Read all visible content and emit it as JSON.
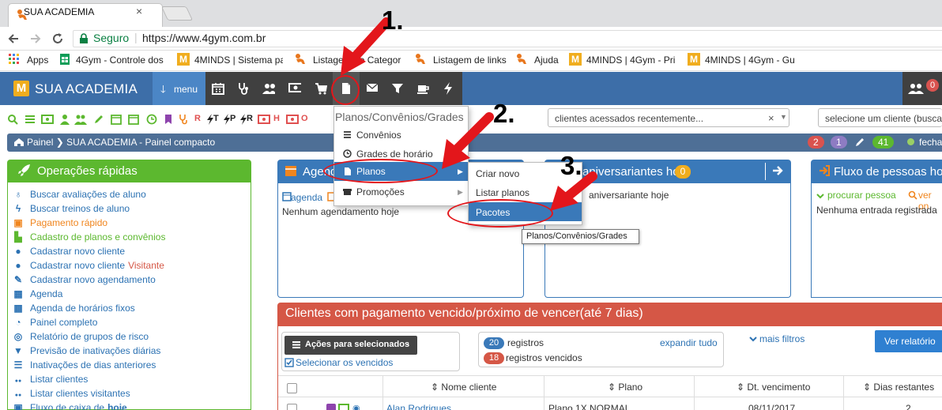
{
  "browser": {
    "tab_title": "SUA ACADEMIA",
    "tab_close": "×",
    "secure_label": "Seguro",
    "url": "https://www.4gym.com.br",
    "bookmarks": [
      {
        "label": "Apps"
      },
      {
        "label": "4Gym - Controle dos"
      },
      {
        "label": "4MINDS | Sistema pa"
      },
      {
        "label": "Listagem de Categor"
      },
      {
        "label": "Listagem de links"
      },
      {
        "label": "Ajuda"
      },
      {
        "label": "4MINDS | 4Gym - Pri"
      },
      {
        "label": "4MINDS | 4Gym - Gu"
      }
    ]
  },
  "nav": {
    "logo_letter": "M",
    "brand": "SUA ACADEMIA",
    "menu_arrow": "🡓",
    "menu_label": "menu",
    "icons": [
      "calendar-icon",
      "stethoscope-icon",
      "users-icon",
      "money-icon",
      "cart-icon",
      "document-icon",
      "envelope-icon",
      "filter-icon",
      "coffee-icon",
      "bolt-icon"
    ],
    "user_badge": "0"
  },
  "quickbar": {
    "letters": [
      "T",
      "P",
      "R",
      "H",
      "O"
    ]
  },
  "selects": {
    "recent_clients": "clientes acessados recentemente...",
    "recent_clear": "×",
    "select_client": "selecione um cliente (busca"
  },
  "breadcrumb": {
    "text": "Painel  ❯  SUA ACADEMIA - Painel compacto",
    "badges": [
      "2",
      "1",
      "41"
    ],
    "close_label": "fecha"
  },
  "quick_ops": {
    "title": "Operações rápidas",
    "items": [
      {
        "label": "Buscar avaliações de aluno",
        "icon": "stethoscope-icon",
        "color": "#2c72b3"
      },
      {
        "label": "Buscar treinos de aluno",
        "icon": "bolt-icon",
        "color": "#2c72b3"
      },
      {
        "label": "Pagamento rápido",
        "icon": "money-icon",
        "color": "#f0851e"
      },
      {
        "label": "Cadastro de planos e convênios",
        "icon": "document-icon",
        "color": "#5cb82f"
      },
      {
        "label": "Cadastrar novo cliente",
        "icon": "user-icon",
        "color": "#2c72b3"
      },
      {
        "label": "Cadastrar novo cliente",
        "extra": "Visitante",
        "icon": "user-icon",
        "color": "#2c72b3"
      },
      {
        "label": "Cadastrar novo agendamento",
        "icon": "pencil-icon",
        "color": "#2c72b3"
      },
      {
        "label": "Agenda",
        "icon": "calendar-icon",
        "color": "#2c72b3"
      },
      {
        "label": "Agenda de horários fixos",
        "icon": "calendar-icon",
        "color": "#2c72b3"
      },
      {
        "label": "Painel completo",
        "icon": "dashboard-icon",
        "color": "#2c72b3"
      },
      {
        "label": "Relatório de grupos de risco",
        "icon": "target-icon",
        "color": "#2c72b3"
      },
      {
        "label": "Previsão de inativações diárias",
        "icon": "thumbs-down-icon",
        "color": "#2c72b3"
      },
      {
        "label": "Inativações de dias anteriores",
        "icon": "list-icon",
        "color": "#2c72b3"
      },
      {
        "label": "Listar clientes",
        "icon": "users-icon",
        "color": "#2c72b3"
      },
      {
        "label": "Listar clientes visitantes",
        "icon": "users-icon",
        "color": "#2c72b3"
      },
      {
        "label": "Fluxo de caixa de",
        "extra": "hoje",
        "icon": "money-icon",
        "color": "#2c72b3"
      }
    ]
  },
  "agenda_panel": {
    "title": "Agend",
    "tab1": "agenda",
    "empty": "Nenhum agendamento hoje"
  },
  "aniversariantes_panel": {
    "title": "aniversariantes hoje",
    "count": "0",
    "empty": "aniversariante hoje"
  },
  "fluxo_panel": {
    "title": "Fluxo de pessoas hoje",
    "search": "procurar pessoa",
    "ver": "ver on",
    "empty": "Nenhuma entrada registrada"
  },
  "menu_dropdown": {
    "header": "Planos/Convênios/Grades",
    "items": [
      {
        "label": "Convênios",
        "icon": "list-icon"
      },
      {
        "label": "Grades de horário",
        "icon": "clock-icon"
      },
      {
        "label": "Planos",
        "icon": "document-icon",
        "active": true
      },
      {
        "label": "Promoções",
        "icon": "gift-icon"
      }
    ],
    "submenu_arrow": "▶"
  },
  "planos_submenu": {
    "items": [
      {
        "label": "Criar novo"
      },
      {
        "label": "Listar planos"
      },
      {
        "label": "Pacotes",
        "active": true
      }
    ]
  },
  "tooltip": "Planos/Convênios/Grades",
  "annotations": {
    "step1": "1.",
    "step2": "2.",
    "step3": "3."
  },
  "clientes_panel": {
    "title": "Clientes com pagamento vencido/próximo de vencer(até 7 dias)",
    "actions_btn": "Ações para selecionados",
    "select_overdue": "Selecionar os vencidos",
    "records_count": "20",
    "records_label": "registros",
    "overdue_count": "18",
    "overdue_label": "registros vencidos",
    "expand_all": "expandir tudo",
    "more_filters": "mais filtros",
    "report_btn": "Ver relatório",
    "columns": [
      "Nome cliente",
      "Plano",
      "Dt. vencimento",
      "Dias restantes"
    ],
    "rows": [
      {
        "name": "Alan Rodrigues",
        "plan": "Plano 1X NORMAL",
        "due": "08/11/2017",
        "days": "2"
      }
    ]
  },
  "colors": {
    "nav_blue": "#3d6ea8",
    "menu_blue": "#4b86c6",
    "dark_bar": "#404040",
    "green": "#5cb82f",
    "panel_blue": "#3a79b9",
    "red_panel": "#d55746",
    "annotation_red": "#e3161b"
  }
}
